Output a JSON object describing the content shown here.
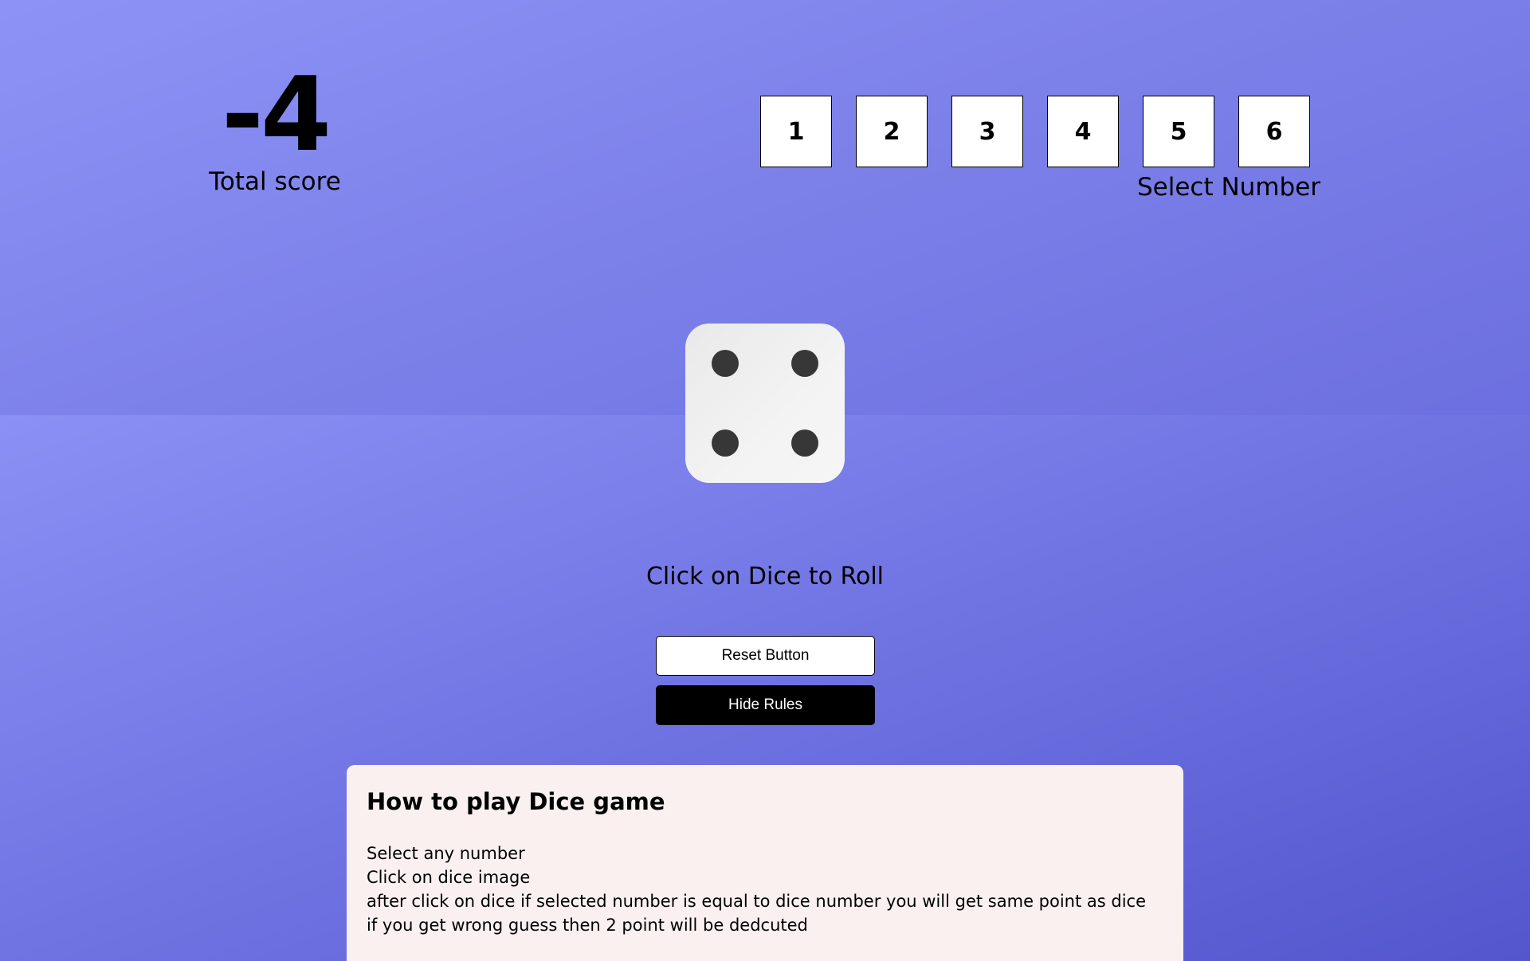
{
  "score": {
    "value": "-4",
    "label": "Total score"
  },
  "number_selector": {
    "numbers": [
      "1",
      "2",
      "3",
      "4",
      "5",
      "6"
    ],
    "label": "Select Number"
  },
  "dice": {
    "face_value": 4,
    "icon": "dice-four-icon"
  },
  "roll_hint": "Click on Dice to Roll",
  "buttons": {
    "reset_label": "Reset Button",
    "hide_rules_label": "Hide Rules"
  },
  "rules": {
    "title": "How to play Dice game",
    "lines": [
      "Select any number",
      "Click on dice image",
      "after click on dice if selected number is equal to dice number you will get same point as dice",
      "if you get wrong guess then 2 point will be dedcuted"
    ]
  },
  "colors": {
    "background_top": "#8d93f6",
    "background_bottom": "#5356cd",
    "dice_face": "#f0f0f0",
    "dice_pip": "#373737",
    "rules_panel": "#fbf0f0",
    "hide_rules_button": "#000000"
  }
}
